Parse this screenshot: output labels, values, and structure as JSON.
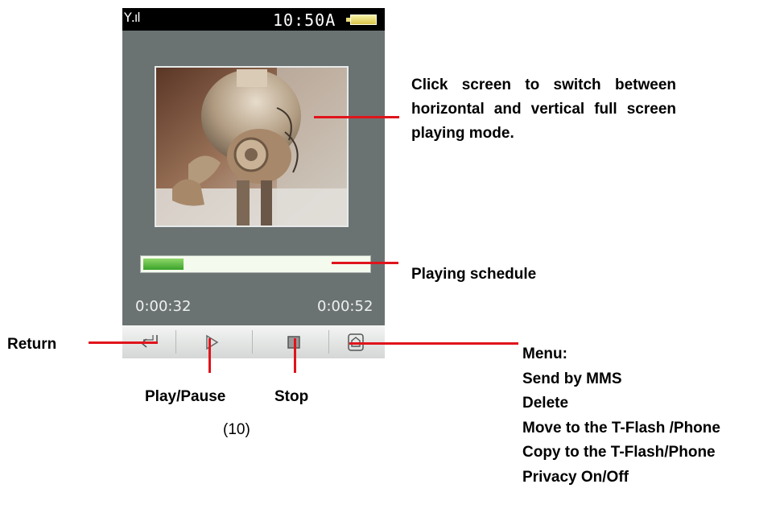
{
  "status_bar": {
    "signal": "Υ.ıl",
    "time": "10:50A"
  },
  "player": {
    "current_time": "0:00:32",
    "total_time": "0:00:52",
    "progress": 0.181
  },
  "toolbar": {
    "buttons": [
      "return",
      "play",
      "stop",
      "menu"
    ]
  },
  "annotations": {
    "video_note": "Click screen to switch between horizontal and vertical full screen playing mode.",
    "progress_note": "Playing schedule",
    "return_label": "Return",
    "play_pause_label": "Play/Pause",
    "stop_label": "Stop",
    "menu_title": "Menu:",
    "menu_items": [
      "Send by MMS",
      "Delete",
      "Move to the T-Flash /Phone",
      "Copy to the T-Flash/Phone",
      "Privacy On/Off"
    ],
    "figure_caption": "(10)"
  },
  "colors": {
    "screen_bg": "#6b7272",
    "annotation_line": "#e0141b",
    "progress_fill": "#4caf3a"
  }
}
